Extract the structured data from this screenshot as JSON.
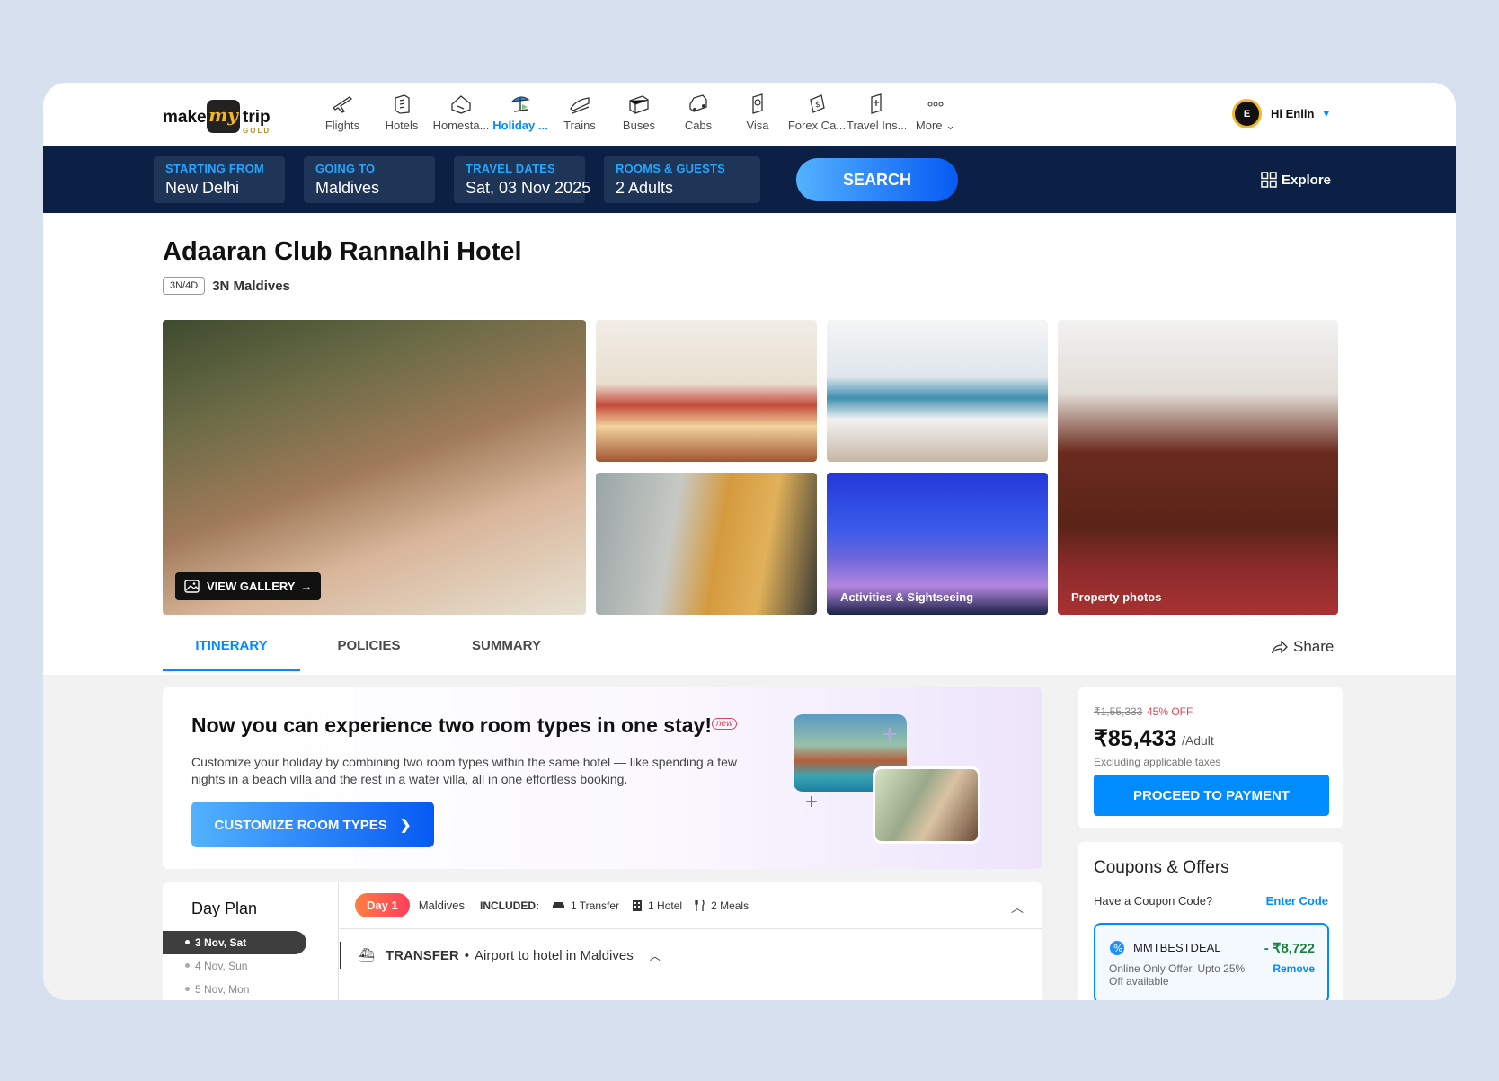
{
  "brand": {
    "make": "make",
    "my": "my",
    "trip": "trip",
    "tier": "GOLD"
  },
  "nav": [
    {
      "label": "Flights",
      "icon": "flight-icon"
    },
    {
      "label": "Hotels",
      "icon": "hotel-icon"
    },
    {
      "label": "Homesta...",
      "icon": "homestay-icon"
    },
    {
      "label": "Holiday ...",
      "icon": "holiday-icon",
      "active": true
    },
    {
      "label": "Trains",
      "icon": "train-icon"
    },
    {
      "label": "Buses",
      "icon": "bus-icon"
    },
    {
      "label": "Cabs",
      "icon": "cab-icon"
    },
    {
      "label": "Visa",
      "icon": "visa-icon"
    },
    {
      "label": "Forex Ca...",
      "icon": "forex-icon"
    },
    {
      "label": "Travel Ins...",
      "icon": "insurance-icon"
    },
    {
      "label": "More",
      "icon": "more-icon"
    }
  ],
  "user": {
    "initial": "E",
    "greeting": "Hi Enlin"
  },
  "search": {
    "from_label": "STARTING FROM",
    "from_value": "New Delhi",
    "to_label": "GOING TO",
    "to_value": "Maldives",
    "dates_label": "TRAVEL DATES",
    "dates_value": "Sat, 03 Nov 2025",
    "rooms_label": "ROOMS & GUESTS",
    "rooms_value": "2 Adults",
    "button": "SEARCH",
    "explore": "Explore"
  },
  "package": {
    "title": "Adaaran Club Rannalhi Hotel",
    "duration": "3N/4D",
    "destination": "3N Maldives"
  },
  "gallery": {
    "view_gallery": "VIEW GALLERY",
    "activities": "Activities & Sightseeing",
    "property": "Property photos"
  },
  "tabs": [
    "ITINERARY",
    "POLICIES",
    "SUMMARY"
  ],
  "share": "Share",
  "promo": {
    "heading": "Now you can experience two room types in one stay!",
    "badge": "new",
    "text": "Customize your holiday by combining two room types within the same hotel — like spending a few nights in a beach villa and the rest in a water villa, all in one effortless booking.",
    "button": "CUSTOMIZE ROOM TYPES"
  },
  "dayplan": {
    "title": "Day Plan",
    "days": [
      "3 Nov, Sat",
      "4 Nov, Sun",
      "5 Nov, Mon"
    ],
    "day_badge": "Day 1",
    "location": "Maldives",
    "included_label": "INCLUDED:",
    "features": [
      "1 Transfer",
      "1 Hotel",
      "2 Meals"
    ],
    "transfer_title": "TRANSFER",
    "transfer_desc": "Airport to hotel in Maldives"
  },
  "price": {
    "original": "₹1,55,333",
    "discount": "45% OFF",
    "amount": "₹85,433",
    "per": "/Adult",
    "tax_note": "Excluding applicable taxes",
    "button": "PROCEED TO PAYMENT"
  },
  "coupons": {
    "title": "Coupons & Offers",
    "have_code": "Have a Coupon Code?",
    "enter_code": "Enter Code",
    "code": "MMTBESTDEAL",
    "amount": "- ₹8,722",
    "desc": "Online Only Offer. Upto 25% Off available",
    "remove": "Remove"
  },
  "colors": {
    "accent": "#008cff",
    "navy": "#0b2044",
    "gold": "#f3b62a"
  }
}
